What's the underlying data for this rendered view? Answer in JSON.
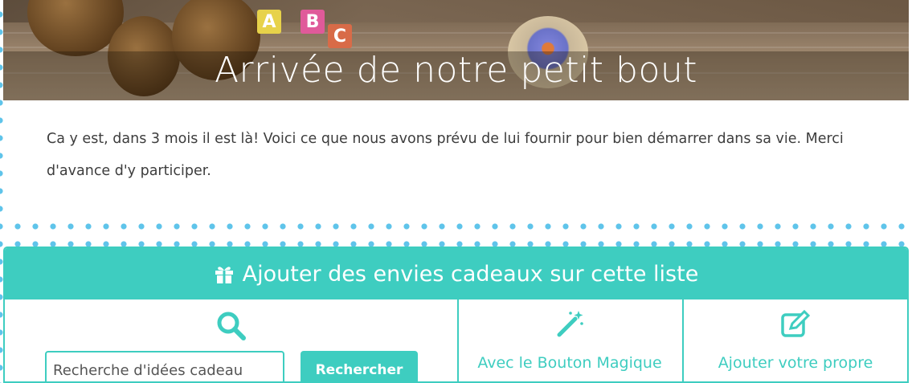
{
  "hero": {
    "title": "Arrivée de notre petit bout",
    "blocks": [
      "A",
      "B",
      "C"
    ]
  },
  "intro": {
    "text": "Ca y est, dans 3 mois il est là! Voici ce que nous avons prévu de lui fournir pour bien démarrer dans sa vie. Merci d'avance d'y participer."
  },
  "panel": {
    "title": "Ajouter des envies cadeaux sur cette liste",
    "icon": "gift-icon",
    "search": {
      "icon": "search-icon",
      "placeholder": "Recherche d'idées cadeau",
      "button_label": "Rechercher"
    },
    "magic": {
      "icon": "magic-wand-icon",
      "label": "Avec le Bouton Magique"
    },
    "own": {
      "icon": "edit-icon",
      "label": "Ajouter votre propre"
    }
  },
  "colors": {
    "accent": "#3ecdc0",
    "dots": "#5fc4ea",
    "text": "#3d3d3d"
  }
}
